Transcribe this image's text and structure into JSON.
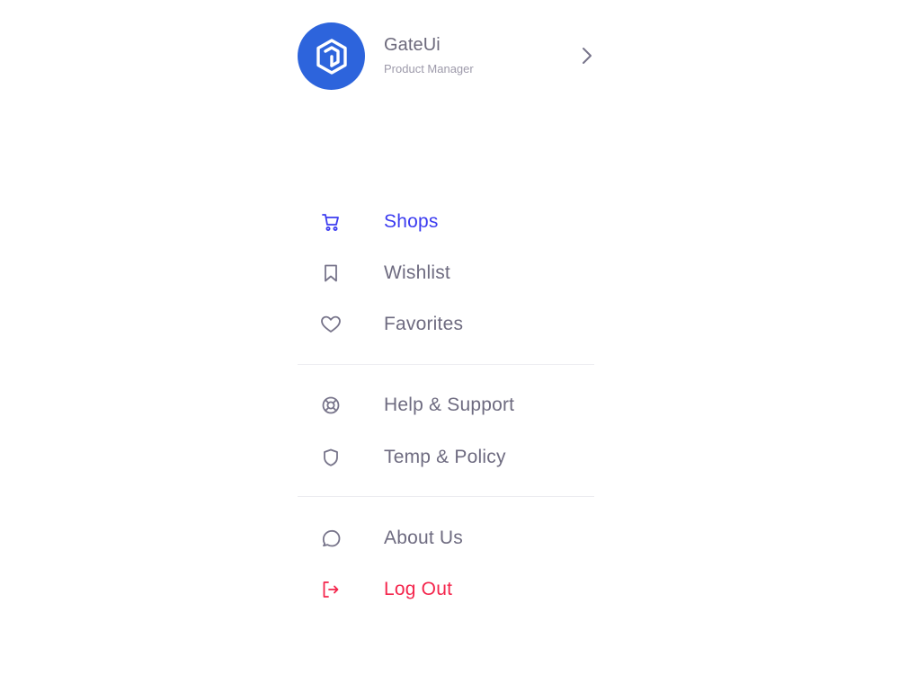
{
  "profile": {
    "name": "GateUi",
    "role": "Product Manager"
  },
  "menu": {
    "primary": [
      {
        "label": "Shops",
        "icon": "shopping-cart-icon",
        "active": true
      },
      {
        "label": "Wishlist",
        "icon": "bookmark-icon"
      },
      {
        "label": "Favorites",
        "icon": "heart-icon"
      }
    ],
    "secondary": [
      {
        "label": "Help & Support",
        "icon": "lifebuoy-icon"
      },
      {
        "label": "Temp & Policy",
        "icon": "shield-icon"
      }
    ],
    "tertiary": [
      {
        "label": "About Us",
        "icon": "chat-bubble-icon"
      },
      {
        "label": "Log Out",
        "icon": "logout-icon",
        "danger": true
      }
    ]
  },
  "colors": {
    "avatar_bg": "#2d64dc",
    "active": "#3c3cf0",
    "danger": "#f4254c",
    "text": "#6e6b80",
    "icon": "#77748a"
  }
}
